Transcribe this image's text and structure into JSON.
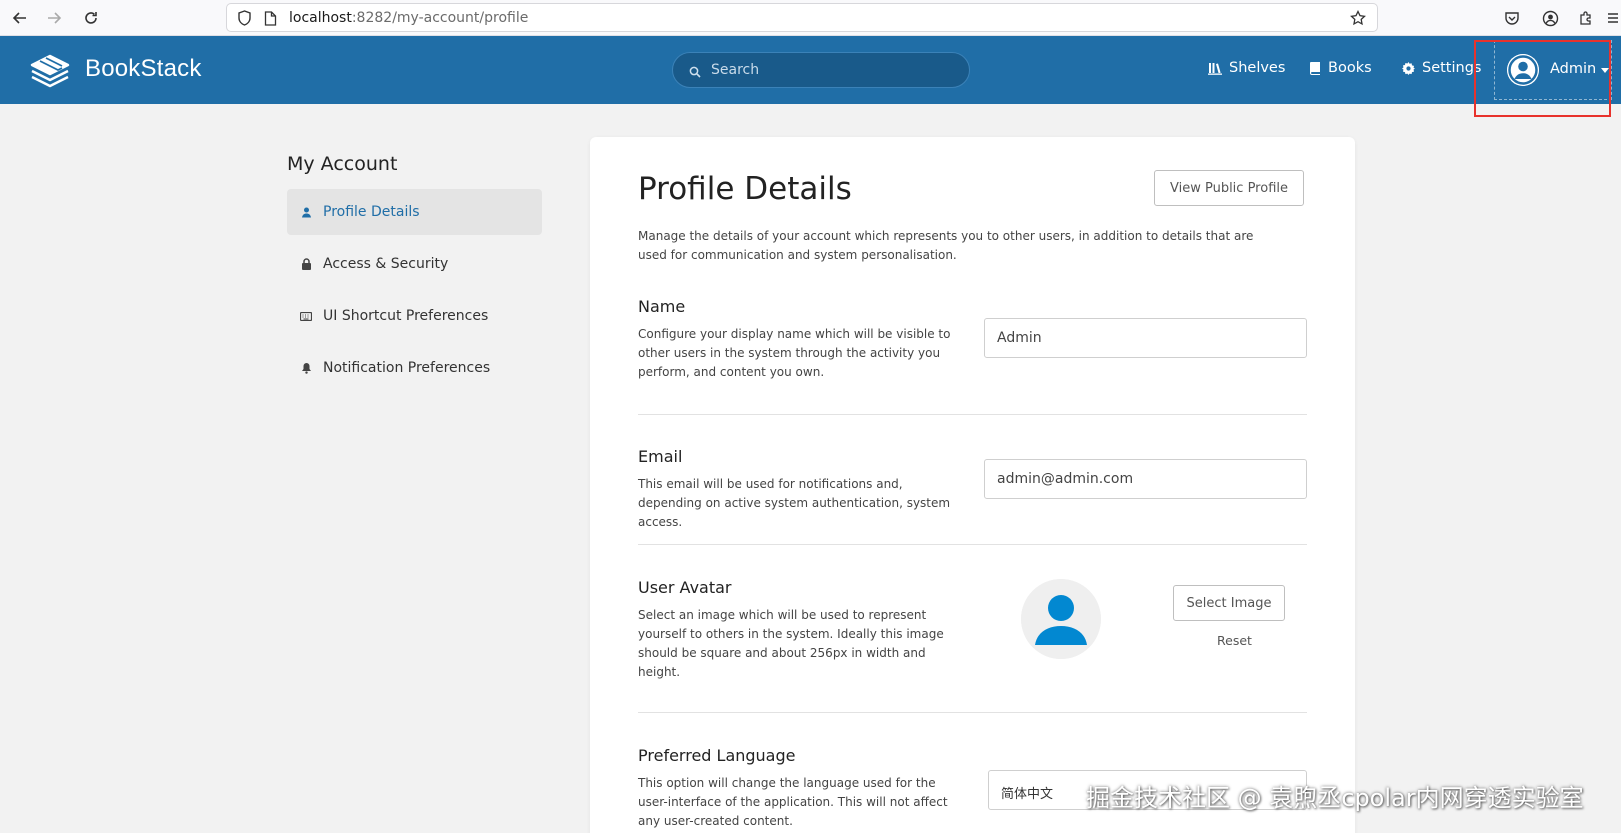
{
  "browser": {
    "url_host": "localhost",
    "url_path": ":8282/my-account/profile"
  },
  "header": {
    "brand": "BookStack",
    "search_placeholder": "Search",
    "nav": {
      "shelves": "Shelves",
      "books": "Books",
      "settings": "Settings"
    },
    "user_name": "Admin"
  },
  "sidebar": {
    "title": "My Account",
    "items": [
      {
        "label": "Profile Details",
        "icon": "user-icon",
        "active": true
      },
      {
        "label": "Access & Security",
        "icon": "lock-icon",
        "active": false
      },
      {
        "label": "UI Shortcut Preferences",
        "icon": "keyboard-icon",
        "active": false
      },
      {
        "label": "Notification Preferences",
        "icon": "bell-icon",
        "active": false
      }
    ]
  },
  "main": {
    "title": "Profile Details",
    "view_public_profile": "View Public Profile",
    "intro": "Manage the details of your account which represents you to other users, in addition to details that are used for communication and system personalisation.",
    "name": {
      "title": "Name",
      "description": "Configure your display name which will be visible to other users in the system through the activity you perform, and content you own.",
      "value": "Admin"
    },
    "email": {
      "title": "Email",
      "description": "This email will be used for notifications and, depending on active system authentication, system access.",
      "value": "admin@admin.com"
    },
    "avatar": {
      "title": "User Avatar",
      "description": "Select an image which will be used to represent yourself to others in the system. Ideally this image should be square and about 256px in width and height.",
      "select_label": "Select Image",
      "reset_label": "Reset"
    },
    "language": {
      "title": "Preferred Language",
      "description": "This option will change the language used for the user-interface of the application. This will not affect any user-created content.",
      "selected": "简体中文"
    }
  },
  "watermark": "掘金技术社区 @ 袁煦丞cpolar内网穿透实验室",
  "colors": {
    "header_bg": "#206ea7",
    "accent": "#206ea7",
    "page_bg": "#f2f2f2",
    "avatar_blue": "#0288d1",
    "highlight": "#e8322c"
  }
}
